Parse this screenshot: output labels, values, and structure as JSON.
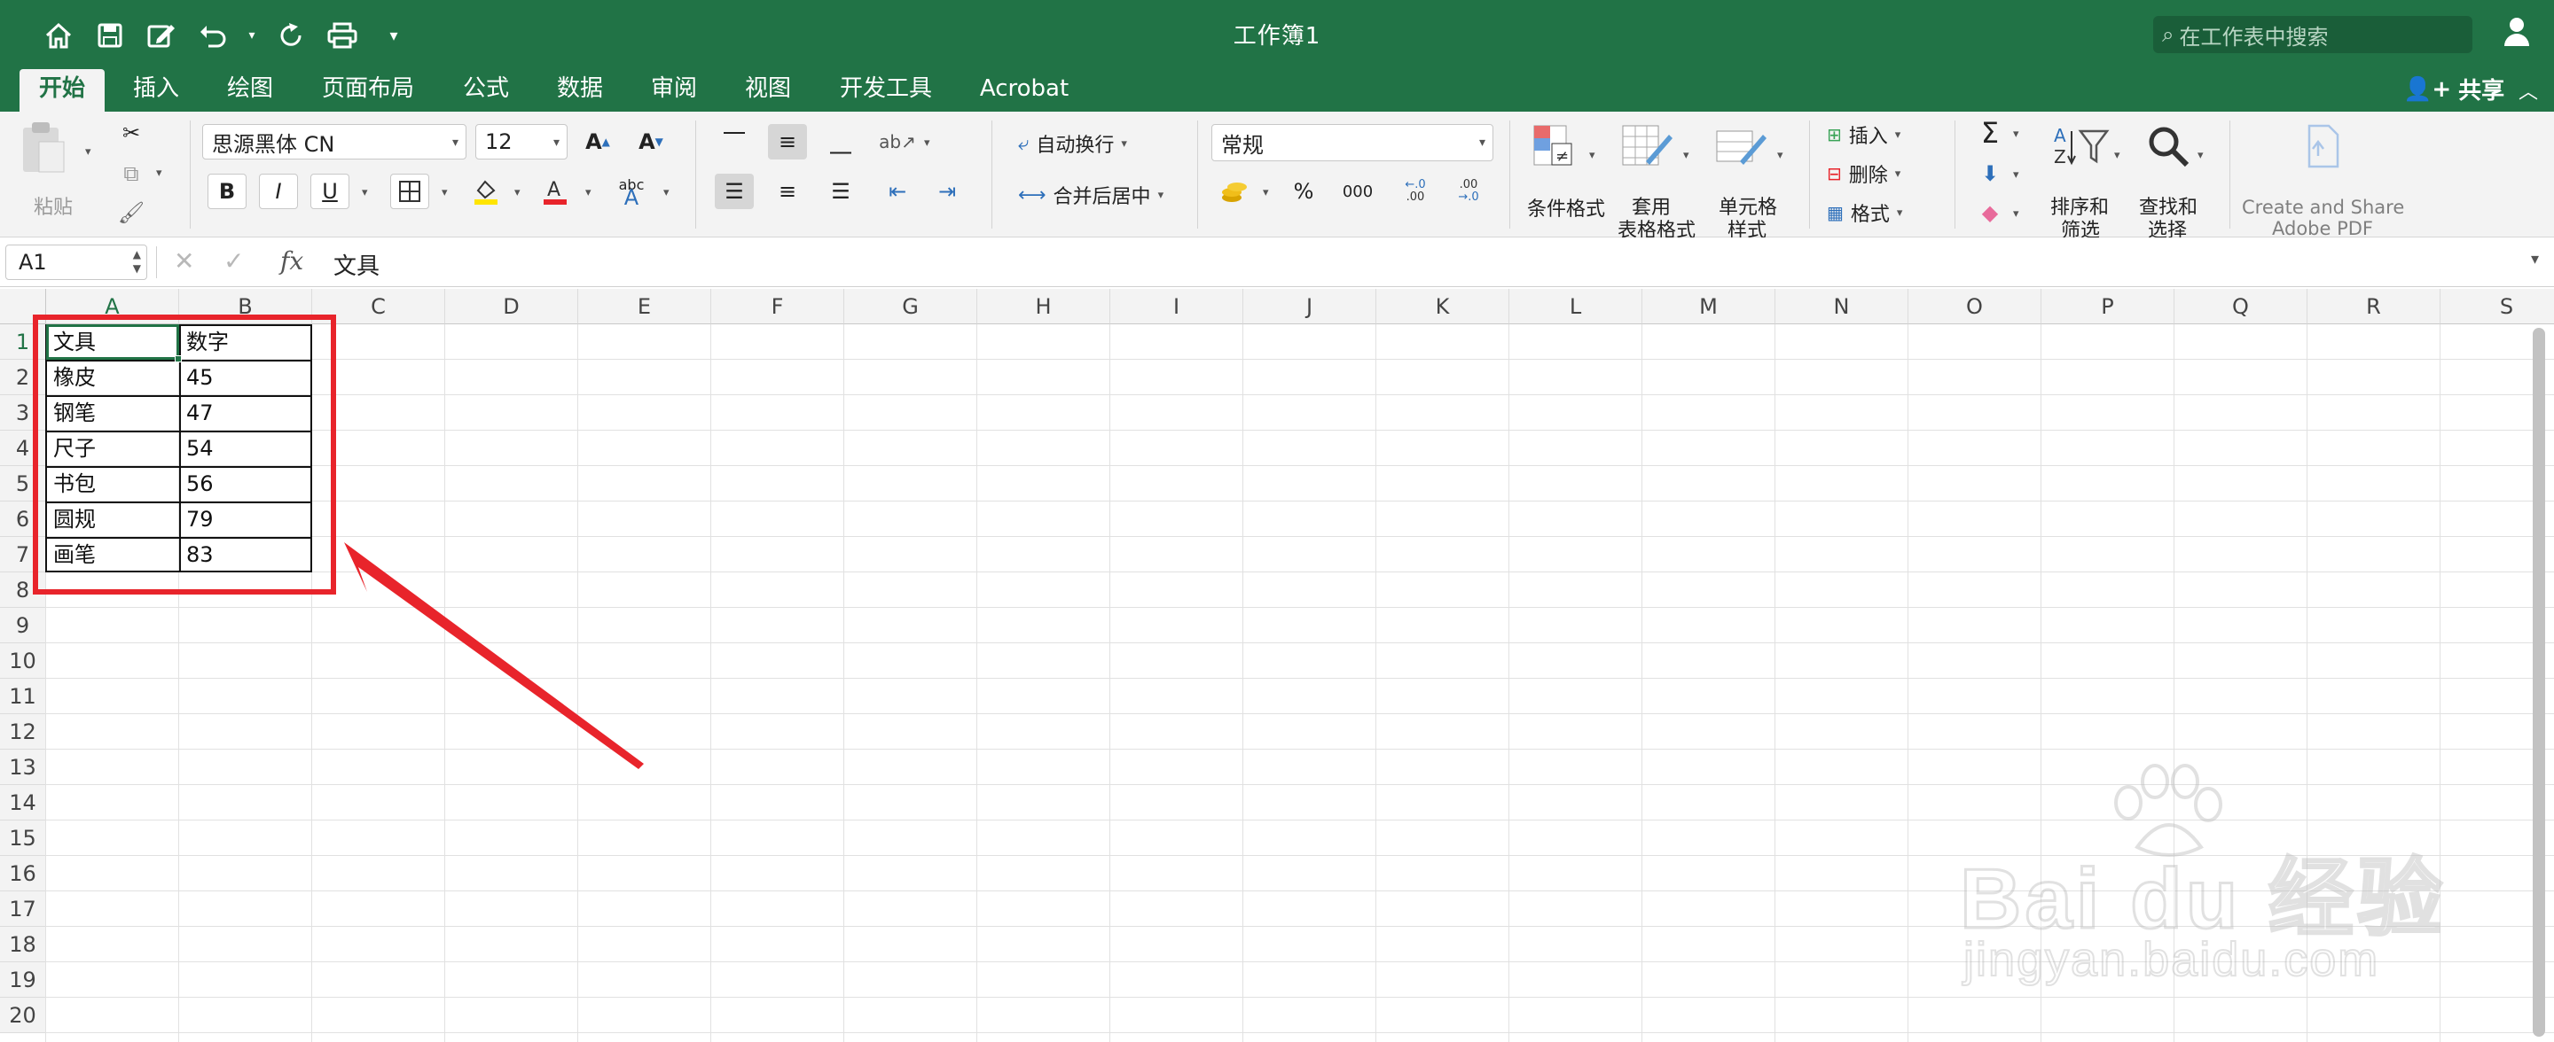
{
  "window": {
    "title": "工作簿1",
    "search_placeholder": "在工作表中搜索"
  },
  "tabs": [
    "开始",
    "插入",
    "绘图",
    "页面布局",
    "公式",
    "数据",
    "审阅",
    "视图",
    "开发工具",
    "Acrobat"
  ],
  "share_label": "共享",
  "ribbon": {
    "paste_label": "粘贴",
    "font_name": "思源黑体 CN",
    "font_size": "12",
    "bold": "B",
    "italic": "I",
    "underline": "U",
    "wrap_text": "自动换行",
    "merge_center": "合并后居中",
    "number_format": "常规",
    "percent": "%",
    "thousands": "000",
    "conditional_format": "条件格式",
    "table_format": [
      "套用",
      "表格格式"
    ],
    "cell_style": [
      "单元格",
      "样式"
    ],
    "insert": "插入",
    "delete": "删除",
    "format": "格式",
    "sort_filter": [
      "排序和",
      "筛选"
    ],
    "find_select": [
      "查找和",
      "选择"
    ],
    "acrobat": [
      "Create and Share",
      "Adobe PDF"
    ]
  },
  "formula_bar": {
    "cell_ref": "A1",
    "fx": "fx",
    "value": "文具"
  },
  "sheet": {
    "columns": [
      "A",
      "B",
      "C",
      "D",
      "E",
      "F",
      "G",
      "H",
      "I",
      "J",
      "K",
      "L",
      "M",
      "N",
      "O",
      "P",
      "Q",
      "R",
      "S"
    ],
    "rows": [
      "1",
      "2",
      "3",
      "4",
      "5",
      "6",
      "7",
      "8",
      "9",
      "10",
      "11",
      "12",
      "13",
      "14",
      "15",
      "16",
      "17",
      "18",
      "19",
      "20"
    ],
    "data": [
      [
        "文具",
        "数字"
      ],
      [
        "橡皮",
        "45"
      ],
      [
        "钢笔",
        "47"
      ],
      [
        "尺子",
        "54"
      ],
      [
        "书包",
        "56"
      ],
      [
        "圆规",
        "79"
      ],
      [
        "画笔",
        "83"
      ]
    ]
  },
  "annotation": {
    "highlight_color": "#e8242b"
  },
  "watermark": {
    "brand": "Bai du 经验",
    "url": "jingyan.baidu.com"
  },
  "colors": {
    "excel_green": "#217346",
    "ribbon_bg": "#f3f3f3"
  }
}
